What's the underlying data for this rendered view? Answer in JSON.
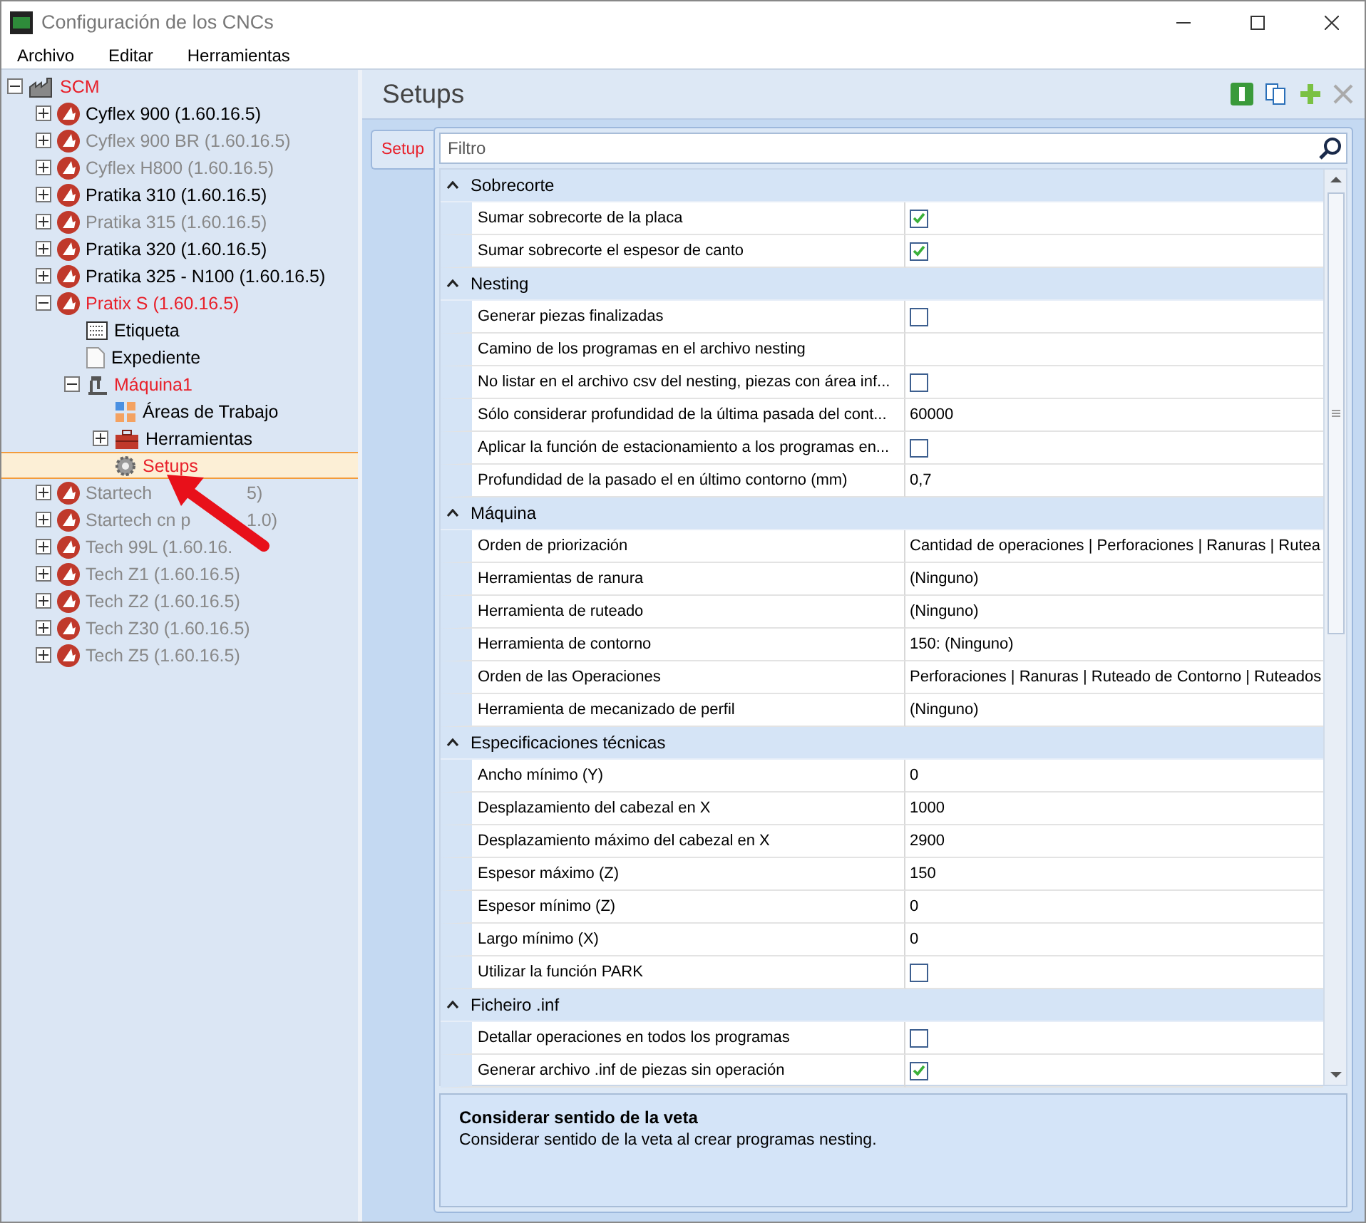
{
  "window": {
    "title": "Configuración de los CNCs"
  },
  "menu": [
    "Archivo",
    "Editar",
    "Herramientas"
  ],
  "tree": [
    {
      "label": "SCM",
      "kind": "factory",
      "expanded": true,
      "active": true,
      "disabled": false,
      "selected": false,
      "children": [
        {
          "label": "Cyflex 900 (1.60.16.5)",
          "kind": "cnc",
          "expanded": false,
          "active": false,
          "disabled": false,
          "selected": false
        },
        {
          "label": "Cyflex 900 BR (1.60.16.5)",
          "kind": "cnc",
          "expanded": false,
          "active": false,
          "disabled": true,
          "selected": false
        },
        {
          "label": "Cyflex H800 (1.60.16.5)",
          "kind": "cnc",
          "expanded": false,
          "active": false,
          "disabled": true,
          "selected": false
        },
        {
          "label": "Pratika 310 (1.60.16.5)",
          "kind": "cnc",
          "expanded": false,
          "active": false,
          "disabled": false,
          "selected": false
        },
        {
          "label": "Pratika 315 (1.60.16.5)",
          "kind": "cnc",
          "expanded": false,
          "active": false,
          "disabled": true,
          "selected": false
        },
        {
          "label": "Pratika 320 (1.60.16.5)",
          "kind": "cnc",
          "expanded": false,
          "active": false,
          "disabled": false,
          "selected": false
        },
        {
          "label": "Pratika 325 - N100 (1.60.16.5)",
          "kind": "cnc",
          "expanded": false,
          "active": false,
          "disabled": false,
          "selected": false
        },
        {
          "label": "Pratix S (1.60.16.5)",
          "kind": "cnc",
          "expanded": true,
          "active": true,
          "disabled": false,
          "selected": false,
          "children": [
            {
              "label": "Etiqueta",
              "kind": "label",
              "active": false,
              "disabled": false,
              "selected": false
            },
            {
              "label": "Expediente",
              "kind": "document",
              "active": false,
              "disabled": false,
              "selected": false
            },
            {
              "label": "Máquina1",
              "kind": "machine",
              "expanded": true,
              "active": true,
              "disabled": false,
              "selected": false,
              "children": [
                {
                  "label": "Áreas de Trabajo",
                  "kind": "grid",
                  "active": false,
                  "disabled": false,
                  "selected": false
                },
                {
                  "label": "Herramientas",
                  "kind": "toolbox",
                  "expanded": false,
                  "active": false,
                  "disabled": false,
                  "selected": false
                },
                {
                  "label": "Setups",
                  "kind": "gear",
                  "active": true,
                  "disabled": false,
                  "selected": true
                }
              ]
            }
          ]
        },
        {
          "label": "Startech",
          "tail": "5)",
          "kind": "cnc",
          "expanded": false,
          "active": false,
          "disabled": true,
          "selected": false
        },
        {
          "label": "Startech cn p",
          "tail": "1.0)",
          "kind": "cnc",
          "expanded": false,
          "active": false,
          "disabled": true,
          "selected": false
        },
        {
          "label": "Tech 99L (1.60.16.",
          "kind": "cnc",
          "expanded": false,
          "active": false,
          "disabled": true,
          "selected": false
        },
        {
          "label": "Tech Z1 (1.60.16.5)",
          "kind": "cnc",
          "expanded": false,
          "active": false,
          "disabled": true,
          "selected": false
        },
        {
          "label": "Tech Z2 (1.60.16.5)",
          "kind": "cnc",
          "expanded": false,
          "active": false,
          "disabled": true,
          "selected": false
        },
        {
          "label": "Tech Z30 (1.60.16.5)",
          "kind": "cnc",
          "expanded": false,
          "active": false,
          "disabled": true,
          "selected": false
        },
        {
          "label": "Tech Z5 (1.60.16.5)",
          "kind": "cnc",
          "expanded": false,
          "active": false,
          "disabled": true,
          "selected": false
        }
      ]
    }
  ],
  "panel": {
    "title": "Setups",
    "tabs": [
      {
        "label": "Setup",
        "selected": true
      }
    ],
    "filter": {
      "placeholder": "Filtro"
    }
  },
  "grid": [
    {
      "kind": "category",
      "name": "Sobrecorte",
      "expanded": true
    },
    {
      "kind": "check",
      "name": "Sumar sobrecorte de la placa",
      "checked": true
    },
    {
      "kind": "check",
      "name": "Sumar sobrecorte el espesor de canto",
      "checked": true
    },
    {
      "kind": "category",
      "name": "Nesting",
      "expanded": true
    },
    {
      "kind": "check",
      "name": "Generar piezas finalizadas",
      "checked": false
    },
    {
      "kind": "text",
      "name": "Camino de los programas en el archivo nesting"
    },
    {
      "kind": "check",
      "name": "No listar en el archivo csv del nesting, piezas con área inf...",
      "checked": false
    },
    {
      "kind": "text",
      "name": "Sólo considerar profundidad de la última pasada del cont...",
      "value": "60000"
    },
    {
      "kind": "check",
      "name": "Aplicar la función de estacionamiento a los programas en...",
      "checked": false
    },
    {
      "kind": "text",
      "name": "Profundidad de la pasado el en último contorno (mm)",
      "value": "0,7"
    },
    {
      "kind": "category",
      "name": "Máquina",
      "expanded": true
    },
    {
      "kind": "text",
      "name": "Orden de priorización",
      "value": "Cantidad de operaciones | Perforaciones | Ranuras | Rutea"
    },
    {
      "kind": "text",
      "name": "Herramientas de ranura",
      "value": "(Ninguno)"
    },
    {
      "kind": "text",
      "name": "Herramienta de ruteado",
      "value": "(Ninguno)"
    },
    {
      "kind": "text",
      "name": "Herramienta de contorno",
      "value": "150: (Ninguno)"
    },
    {
      "kind": "text",
      "name": "Orden de las Operaciones",
      "value": "Perforaciones | Ranuras | Ruteado de Contorno | Ruteados"
    },
    {
      "kind": "text",
      "name": "Herramienta de mecanizado de perfil",
      "value": "(Ninguno)"
    },
    {
      "kind": "category",
      "name": "Especificaciones técnicas",
      "expanded": true
    },
    {
      "kind": "text",
      "name": "Ancho mínimo (Y)",
      "value": "0"
    },
    {
      "kind": "text",
      "name": "Desplazamiento del cabezal en X",
      "value": "1000"
    },
    {
      "kind": "text",
      "name": "Desplazamiento máximo del cabezal en X",
      "value": "2900"
    },
    {
      "kind": "text",
      "name": "Espesor máximo (Z)",
      "value": "150"
    },
    {
      "kind": "text",
      "name": "Espesor mínimo (Z)",
      "value": "0"
    },
    {
      "kind": "text",
      "name": "Largo mínimo (X)",
      "value": "0"
    },
    {
      "kind": "check",
      "name": "Utilizar la función PARK",
      "checked": false
    },
    {
      "kind": "category",
      "name": "Ficheiro .inf",
      "expanded": true
    },
    {
      "kind": "check",
      "name": "Detallar operaciones en todos los programas",
      "checked": false
    },
    {
      "kind": "check",
      "name": "Generar archivo .inf de piezas sin operación",
      "checked": true
    }
  ],
  "description": {
    "title": "Considerar sentido de la veta",
    "text": "Considerar sentido de la veta al crear programas nesting."
  }
}
